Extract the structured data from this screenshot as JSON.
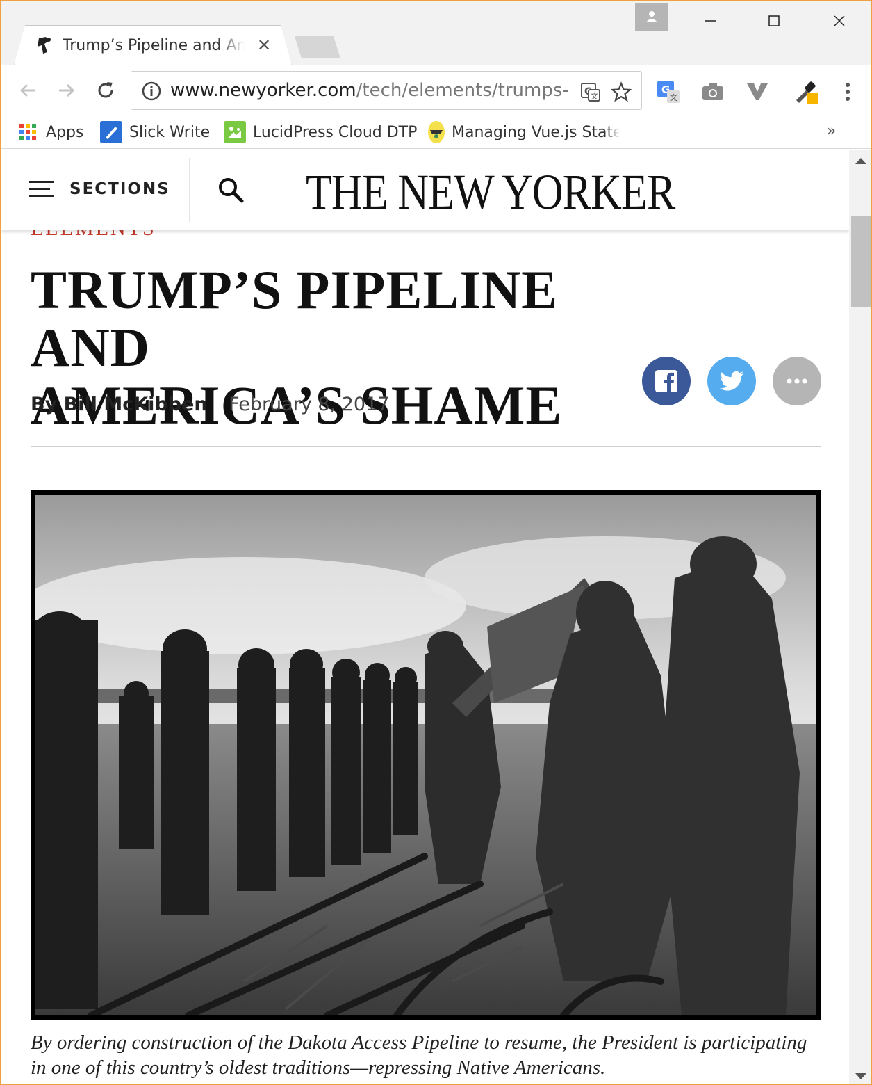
{
  "browser": {
    "tab_title": "Trump’s Pipeline and America’s Shame",
    "url_host": "www.newyorker.com",
    "url_path": "/tech/elements/trumps-pi"
  },
  "bookmarks": [
    {
      "label": "Apps",
      "icon": "apps-grid-icon"
    },
    {
      "label": "Slick Write",
      "icon": "slick-write-icon"
    },
    {
      "label": "LucidPress Cloud DTP",
      "icon": "lucidpress-icon"
    },
    {
      "label": "Managing Vue.js State",
      "icon": "vue-state-icon"
    }
  ],
  "site": {
    "sections_label": "SECTIONS",
    "masthead": "THE NEW YORKER"
  },
  "article": {
    "rubric": "ELEMENTS",
    "headline_line1": "TRUMP’S PIPELINE AND",
    "headline_line2": "AMERICA’S SHAME",
    "author": "By Bill McKibben",
    "date": "February 8, 2017",
    "caption_line1": "By ordering construction of the Dakota Access Pipeline to resume, the President is participating",
    "caption_line2": "in one of this country’s oldest traditions—repressing Native Americans."
  },
  "colors": {
    "facebook": "#3b5998",
    "twitter": "#55acee",
    "more": "#b5b5b5",
    "rubric": "#c0392b",
    "window_border": "#f0a040"
  }
}
